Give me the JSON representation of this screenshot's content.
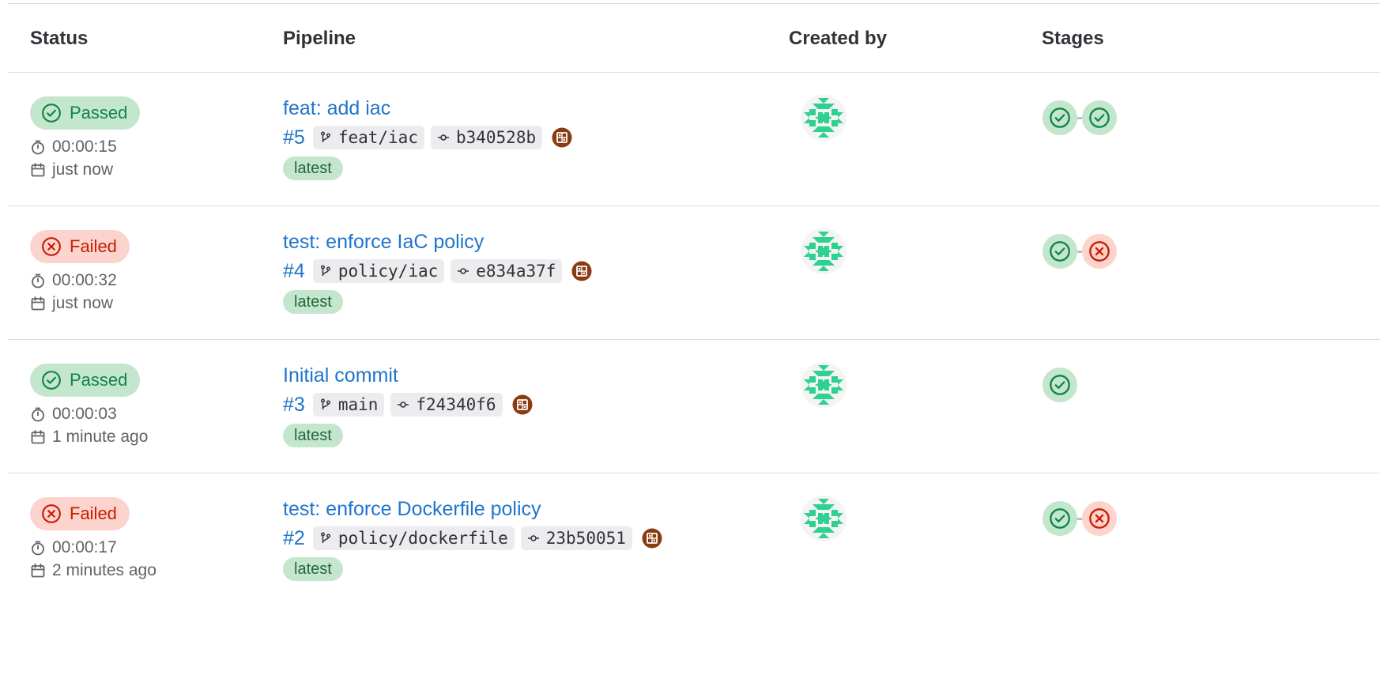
{
  "headers": {
    "status": "Status",
    "pipeline": "Pipeline",
    "created_by": "Created by",
    "stages": "Stages"
  },
  "colors": {
    "link": "#1f75cb",
    "success": "#108548",
    "success_bg": "#c3e6cd",
    "danger": "#c91c00",
    "danger_bg": "#fdd4cd",
    "avatar": "#2ed18f"
  },
  "rows": [
    {
      "status": "Passed",
      "duration": "00:00:15",
      "date": "just now",
      "title": "feat: add iac",
      "id": "#5",
      "branch": "feat/iac",
      "commit": "b340528b",
      "tag": "latest",
      "stages": [
        "passed",
        "passed"
      ]
    },
    {
      "status": "Failed",
      "duration": "00:00:32",
      "date": "just now",
      "title": "test: enforce IaC policy",
      "id": "#4",
      "branch": "policy/iac",
      "commit": "e834a37f",
      "tag": "latest",
      "stages": [
        "passed",
        "failed"
      ]
    },
    {
      "status": "Passed",
      "duration": "00:00:03",
      "date": "1 minute ago",
      "title": "Initial commit",
      "id": "#3",
      "branch": "main",
      "commit": "f24340f6",
      "tag": "latest",
      "stages": [
        "passed"
      ]
    },
    {
      "status": "Failed",
      "duration": "00:00:17",
      "date": "2 minutes ago",
      "title": "test: enforce Dockerfile policy",
      "id": "#2",
      "branch": "policy/dockerfile",
      "commit": "23b50051",
      "tag": "latest",
      "stages": [
        "passed",
        "failed"
      ]
    }
  ]
}
